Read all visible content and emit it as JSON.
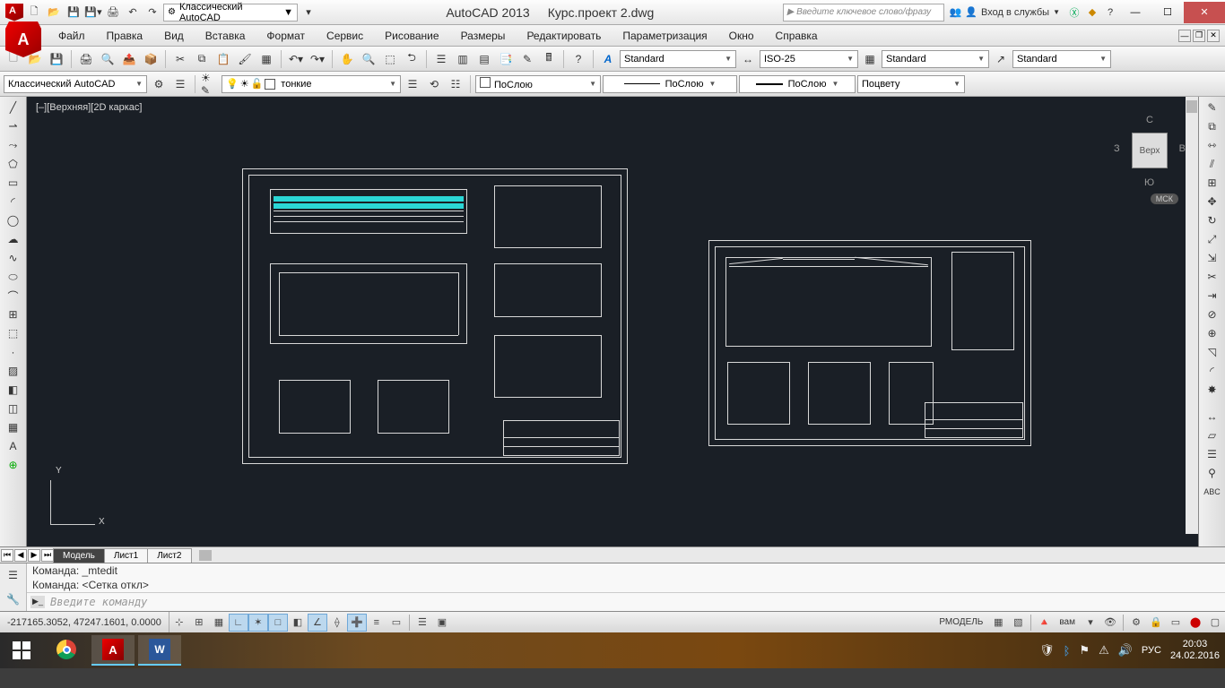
{
  "title": {
    "app": "AutoCAD 2013",
    "file": "Курс.проект 2.dwg"
  },
  "search_placeholder": "Введите ключевое слово/фразу",
  "signin": "Вход в службы",
  "workspace_qat": "Классический AutoCAD",
  "menu": [
    "Файл",
    "Правка",
    "Вид",
    "Вставка",
    "Формат",
    "Сервис",
    "Рисование",
    "Размеры",
    "Редактировать",
    "Параметризация",
    "Окно",
    "Справка"
  ],
  "styles": {
    "text": "Standard",
    "dim": "ISO-25",
    "table": "Standard",
    "mleader": "Standard"
  },
  "workspace_combo": "Классический AutoCAD",
  "layer_combo": "тонкие",
  "props": {
    "color": "ПоСлою",
    "ltype": "ПоСлою",
    "lweight": "ПоСлою",
    "plot": "Поцвету"
  },
  "viewport_label": "[–][Верхняя][2D каркас]",
  "viewcube": {
    "face": "Верх",
    "N": "С",
    "S": "Ю",
    "E": "В",
    "W": "З",
    "ucs": "МСК"
  },
  "tabs": {
    "model": "Модель",
    "l1": "Лист1",
    "l2": "Лист2"
  },
  "cmd": {
    "l1": "Команда: _mtedit",
    "l2": "Команда: <Сетка откл>",
    "placeholder": "Введите команду"
  },
  "status": {
    "coords": "-217165.3052, 47247.1601, 0.0000",
    "space": "РМОДЕЛЬ",
    "annoscale": "вам"
  },
  "tray": {
    "lang": "РУС",
    "time": "20:03",
    "date": "24.02.2016"
  }
}
